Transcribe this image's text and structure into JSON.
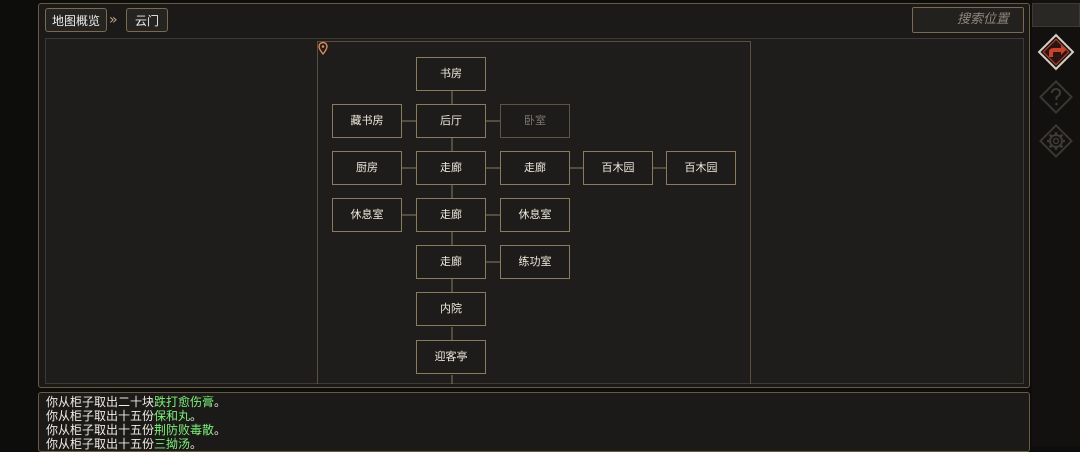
{
  "breadcrumb": {
    "overview": "地图概览",
    "separator": "»",
    "current": "云门"
  },
  "search": {
    "placeholder": "搜索位置"
  },
  "rooms": [
    {
      "id": "study",
      "label": "书房"
    },
    {
      "id": "library",
      "label": "藏书房"
    },
    {
      "id": "back-hall",
      "label": "后厅"
    },
    {
      "id": "bedroom",
      "label": "卧室",
      "dim": true
    },
    {
      "id": "kitchen",
      "label": "厨房"
    },
    {
      "id": "corridor-1",
      "label": "走廊"
    },
    {
      "id": "corridor-2",
      "label": "走廊"
    },
    {
      "id": "garden-1",
      "label": "百木园"
    },
    {
      "id": "garden-2",
      "label": "百木园"
    },
    {
      "id": "lounge-1",
      "label": "休息室"
    },
    {
      "id": "corridor-3",
      "label": "走廊"
    },
    {
      "id": "lounge-2",
      "label": "休息室"
    },
    {
      "id": "corridor-4",
      "label": "走廊"
    },
    {
      "id": "training-room",
      "label": "练功室"
    },
    {
      "id": "inner-court",
      "label": "内院"
    },
    {
      "id": "guest-pavilion",
      "label": "迎客亭"
    }
  ],
  "current_location_icon": "map-pin-icon",
  "side_buttons": [
    {
      "name": "return-arrow-icon",
      "active": true
    },
    {
      "name": "help-icon",
      "active": false
    },
    {
      "name": "settings-gear-icon",
      "active": false
    }
  ],
  "log": [
    {
      "prefix": "你从柜子取出二十块",
      "item": "跌打愈伤膏",
      "suffix": "。"
    },
    {
      "prefix": "你从柜子取出十五份",
      "item": "保和丸",
      "suffix": "。"
    },
    {
      "prefix": "你从柜子取出十五份",
      "item": "荆防败毒散",
      "suffix": "。"
    },
    {
      "prefix": "你从柜子取出十五份",
      "item": "三拗汤",
      "suffix": "。"
    }
  ],
  "colors": {
    "accent_border": "#8a7a5e",
    "item_highlight": "#7ef07a",
    "active_icon": "#c8432c"
  }
}
